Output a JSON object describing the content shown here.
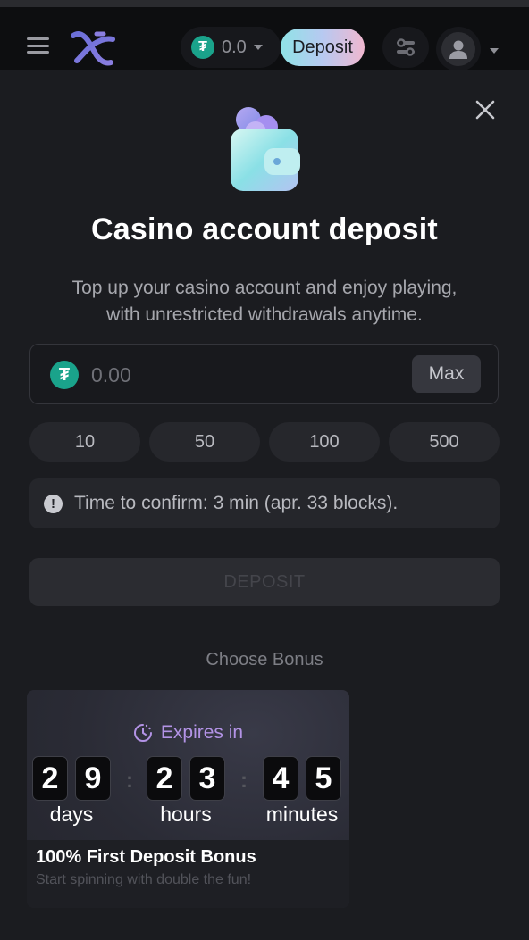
{
  "header": {
    "balance": "0.0",
    "currency_icon": "tether-icon",
    "deposit_label": "Deposit"
  },
  "modal": {
    "title": "Casino account deposit",
    "subtitle_line1": "Top up your casino account and enjoy playing,",
    "subtitle_line2": "with unrestricted withdrawals anytime.",
    "amount_placeholder": "0.00",
    "max_label": "Max",
    "presets": [
      "10",
      "50",
      "100",
      "500"
    ],
    "info_text": "Time to confirm: 3 min (apr. 33 blocks).",
    "deposit_label": "DEPOSIT"
  },
  "bonus": {
    "section_label": "Choose Bonus",
    "expires_label": "Expires in",
    "countdown": {
      "days": [
        "2",
        "9"
      ],
      "hours": [
        "2",
        "3"
      ],
      "minutes": [
        "4",
        "5"
      ]
    },
    "units": {
      "days": "days",
      "hours": "hours",
      "minutes": "minutes"
    },
    "title": "100% First Deposit Bonus",
    "description": "Start spinning with double the fun!"
  },
  "colors": {
    "tether": "#1aa38b",
    "expires_accent": "#b393e6",
    "background": "#1b1c20"
  }
}
